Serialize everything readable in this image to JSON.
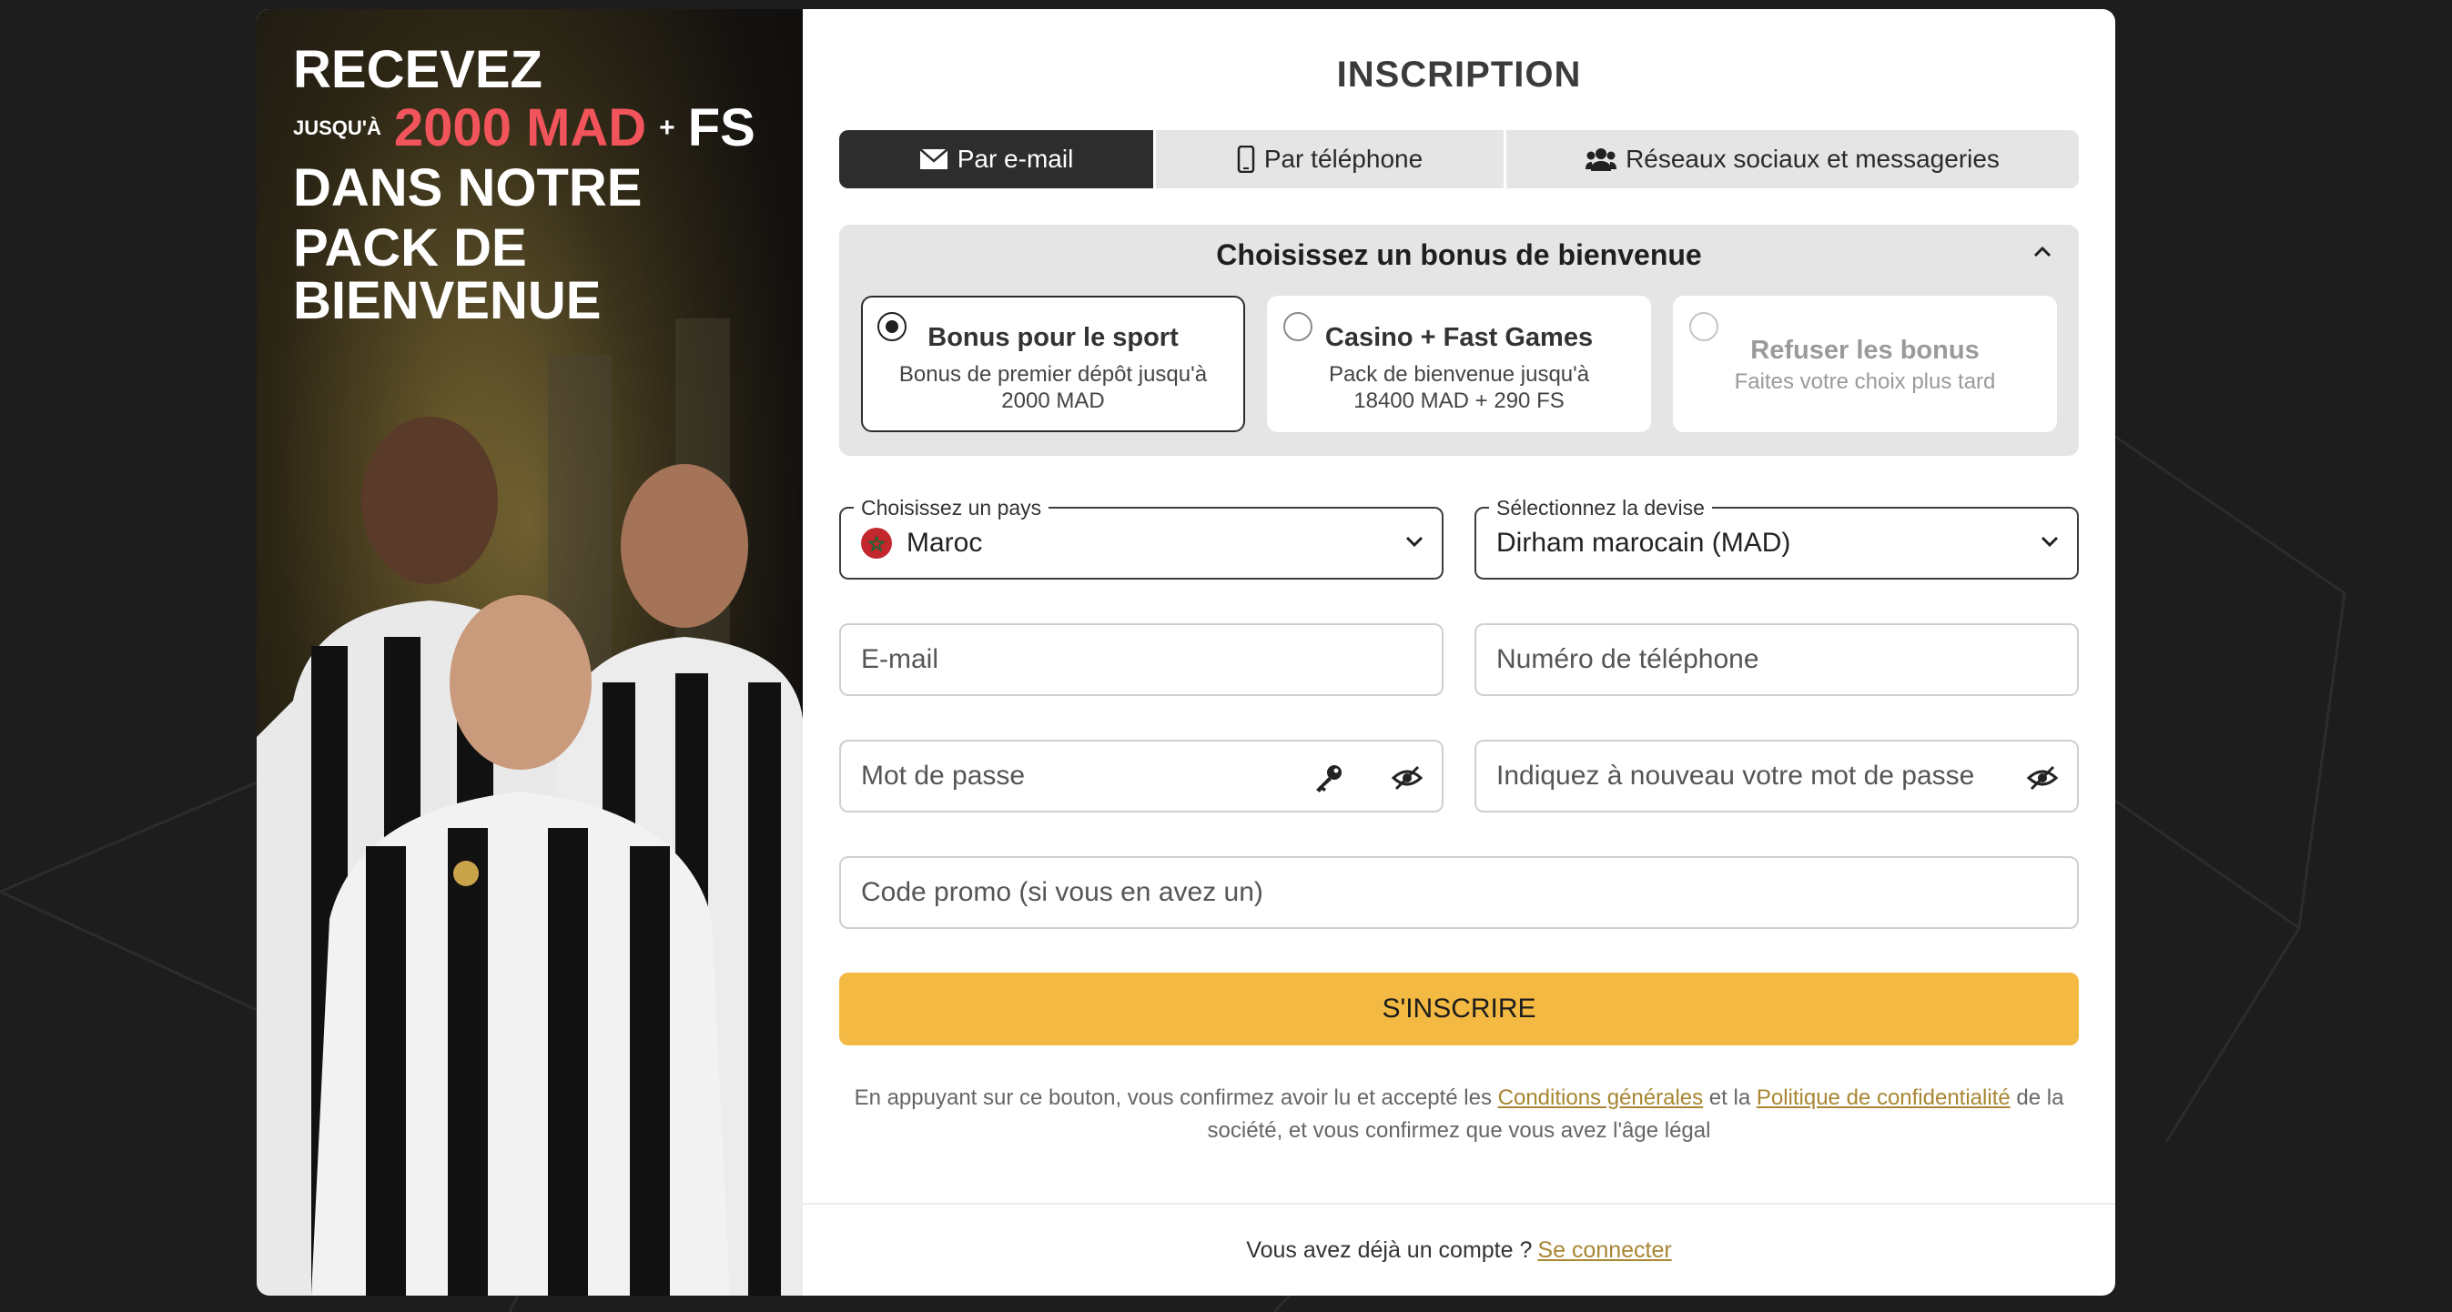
{
  "banner": {
    "line1": "RECEVEZ",
    "upto": "JUSQU'À",
    "amount": "2000 MAD",
    "plus": "+",
    "fs": "FS",
    "line3": "DANS NOTRE",
    "line4": "PACK DE BIENVENUE"
  },
  "form": {
    "title": "INSCRIPTION",
    "tabs": [
      {
        "label": "Par e-mail",
        "icon": "envelope-icon",
        "active": true
      },
      {
        "label": "Par téléphone",
        "icon": "phone-icon",
        "active": false
      },
      {
        "label": "Réseaux sociaux et messageries",
        "icon": "users-icon",
        "active": false
      }
    ],
    "bonus": {
      "heading": "Choisissez un bonus de bienvenue",
      "options": [
        {
          "title": "Bonus pour le sport",
          "desc": "Bonus de premier dépôt jusqu'à 2000 MAD",
          "selected": true
        },
        {
          "title": "Casino + Fast Games",
          "desc": "Pack de bienvenue jusqu'à 18400 MAD + 290 FS",
          "selected": false
        },
        {
          "title": "Refuser les bonus",
          "desc": "Faites votre choix plus tard",
          "selected": false
        }
      ]
    },
    "country": {
      "legend": "Choisissez un pays",
      "value": "Maroc"
    },
    "currency": {
      "legend": "Sélectionnez la devise",
      "value": "Dirham marocain (MAD)"
    },
    "email_placeholder": "E-mail",
    "phone_placeholder": "Numéro de téléphone",
    "password_placeholder": "Mot de passe",
    "password_repeat_placeholder": "Indiquez à nouveau votre mot de passe",
    "promo_placeholder": "Code promo (si vous en avez un)",
    "submit_label": "S'INSCRIRE",
    "legal": {
      "prefix": "En appuyant sur ce bouton, vous confirmez avoir lu et accepté les",
      "terms_link": "Conditions générales",
      "middle": "et la",
      "privacy_link": "Politique de confidentialité",
      "suffix": "de la société, et vous confirmez que vous avez l'âge légal"
    },
    "footer": {
      "text": "Vous avez déjà un compte ?",
      "login_link": "Se connecter"
    }
  },
  "colors": {
    "accent": "#f4b942",
    "link": "#a88632",
    "banner_red": "#f2545b",
    "active_tab": "#2d2d2d"
  }
}
